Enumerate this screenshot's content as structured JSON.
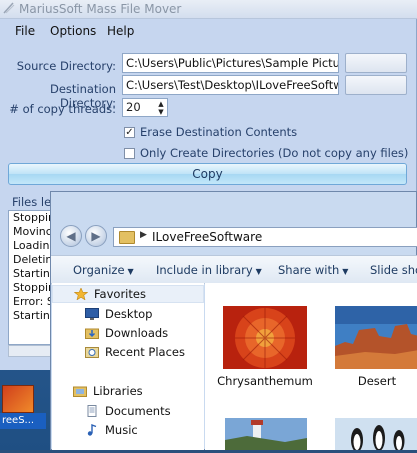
{
  "app": {
    "title": "MariusSoft Mass File Mover",
    "menu": [
      "File",
      "Options",
      "Help"
    ],
    "source_label": "Source Directory:",
    "source_value": "C:\\Users\\Public\\Pictures\\Sample Pictures",
    "dest_label": "Destination Directory:",
    "dest_value": "C:\\Users\\Test\\Desktop\\ILoveFreeSoftware",
    "threads_label": "# of copy threads:",
    "threads_value": "20",
    "erase_label": "Erase Destination Contents",
    "erase_checked": true,
    "only_dirs_label": "Only Create Directories (Do not copy any files)",
    "only_dirs_checked": false,
    "copy_label": "Copy",
    "files_left_label": "Files lef",
    "log": [
      "Stoppin",
      "Movinc",
      "Loadin",
      "Deletin",
      "Startinc",
      "Stoppin",
      "Error: S",
      "Starting"
    ]
  },
  "desktop": {
    "icon_label": "reeS..."
  },
  "explorer": {
    "address": "ILoveFreeSoftware",
    "commands": [
      "Organize",
      "Include in library",
      "Share with",
      "Slide show"
    ],
    "nav": {
      "favorites_label": "Favorites",
      "favorites": [
        "Desktop",
        "Downloads",
        "Recent Places"
      ],
      "libraries_label": "Libraries",
      "libraries": [
        "Documents",
        "Music"
      ]
    },
    "items": [
      {
        "name": "Chrysanthemum"
      },
      {
        "name": "Desert"
      }
    ]
  },
  "colors": {
    "window_bg": "#c6d6ef",
    "label_blue": "#27416b",
    "copy_button": "#bfe3f7"
  }
}
